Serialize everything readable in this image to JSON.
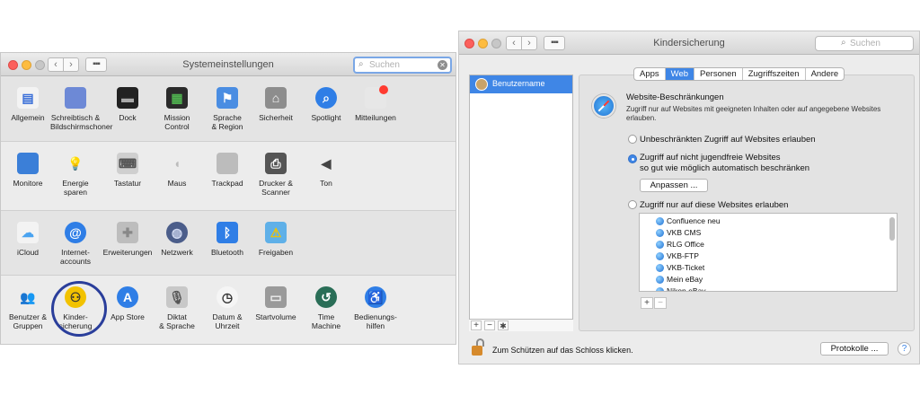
{
  "left_window": {
    "title": "Systemeinstellungen",
    "search_placeholder": "Suchen",
    "rows": [
      [
        {
          "name": "allgemein",
          "label": "Allgemein",
          "icon": "file-icon"
        },
        {
          "name": "schreibtisch",
          "label": "Schreibtisch &\nBildschirmschoner",
          "icon": "desktop-icon"
        },
        {
          "name": "dock",
          "label": "Dock",
          "icon": "dock-icon"
        },
        {
          "name": "mission-control",
          "label": "Mission\nControl",
          "icon": "mission-control-icon"
        },
        {
          "name": "sprache-region",
          "label": "Sprache\n& Region",
          "icon": "flag-icon"
        },
        {
          "name": "sicherheit",
          "label": "Sicherheit",
          "icon": "house-icon"
        },
        {
          "name": "spotlight",
          "label": "Spotlight",
          "icon": "search-icon"
        },
        {
          "name": "mitteilungen",
          "label": "Mitteilungen",
          "icon": "notification-icon"
        }
      ],
      [
        {
          "name": "monitore",
          "label": "Monitore",
          "icon": "monitor-icon"
        },
        {
          "name": "energie-sparen",
          "label": "Energie\nsparen",
          "icon": "bulb-icon"
        },
        {
          "name": "tastatur",
          "label": "Tastatur",
          "icon": "keyboard-icon"
        },
        {
          "name": "maus",
          "label": "Maus",
          "icon": "mouse-icon"
        },
        {
          "name": "trackpad",
          "label": "Trackpad",
          "icon": "trackpad-icon"
        },
        {
          "name": "drucker-scanner",
          "label": "Drucker &\nScanner",
          "icon": "printer-icon"
        },
        {
          "name": "ton",
          "label": "Ton",
          "icon": "speaker-icon"
        }
      ],
      [
        {
          "name": "icloud",
          "label": "iCloud",
          "icon": "cloud-icon"
        },
        {
          "name": "internet-accounts",
          "label": "Internet-\naccounts",
          "icon": "at-icon"
        },
        {
          "name": "erweiterungen",
          "label": "Erweiterungen",
          "icon": "puzzle-icon"
        },
        {
          "name": "netzwerk",
          "label": "Netzwerk",
          "icon": "globe-icon"
        },
        {
          "name": "bluetooth",
          "label": "Bluetooth",
          "icon": "bluetooth-icon"
        },
        {
          "name": "freigaben",
          "label": "Freigaben",
          "icon": "folder-icon"
        }
      ],
      [
        {
          "name": "benutzer-gruppen",
          "label": "Benutzer &\nGruppen",
          "icon": "users-icon"
        },
        {
          "name": "kindersicherung",
          "label": "Kinder-\nsicherung",
          "icon": "parental-icon"
        },
        {
          "name": "app-store",
          "label": "App Store",
          "icon": "appstore-icon"
        },
        {
          "name": "diktat-sprache",
          "label": "Diktat\n& Sprache",
          "icon": "microphone-icon"
        },
        {
          "name": "datum-uhrzeit",
          "label": "Datum &\nUhrzeit",
          "icon": "clock-icon"
        },
        {
          "name": "startvolume",
          "label": "Startvolume",
          "icon": "disk-icon"
        },
        {
          "name": "time-machine",
          "label": "Time\nMachine",
          "icon": "time-machine-icon"
        },
        {
          "name": "bedienungshilfen",
          "label": "Bedienungs-\nhilfen",
          "icon": "accessibility-icon"
        }
      ]
    ]
  },
  "right_window": {
    "title": "Kindersicherung",
    "search_placeholder": "Suchen",
    "sidebar_user": "Benutzername",
    "tabs": [
      "Apps",
      "Web",
      "Personen",
      "Zugriffszeiten",
      "Andere"
    ],
    "selected_tab": "Web",
    "section_title": "Website-Beschränkungen",
    "section_desc": "Zugriff nur auf Websites mit geeigneten Inhalten oder auf angegebene Websites erlauben.",
    "option1": "Unbeschränkten Zugriff auf Websites erlauben",
    "option2_line1": "Zugriff auf nicht jugendfreie Websites",
    "option2_line2": "so gut wie möglich automatisch beschränken",
    "customize_button": "Anpassen ...",
    "option3": "Zugriff nur auf diese Websites erlauben",
    "selected_option": 2,
    "sites": [
      "Confluence neu",
      "VKB CMS",
      "RLG Office",
      "VKB-FTP",
      "VKB-Ticket",
      "Mein eBay",
      "Nikon eBay"
    ],
    "lock_text": "Zum Schützen auf das Schloss klicken.",
    "log_button": "Protokolle ...",
    "help": "?"
  },
  "colors": {
    "accent": "#3f86e6",
    "highlight_ring": "#2a3e9b"
  }
}
